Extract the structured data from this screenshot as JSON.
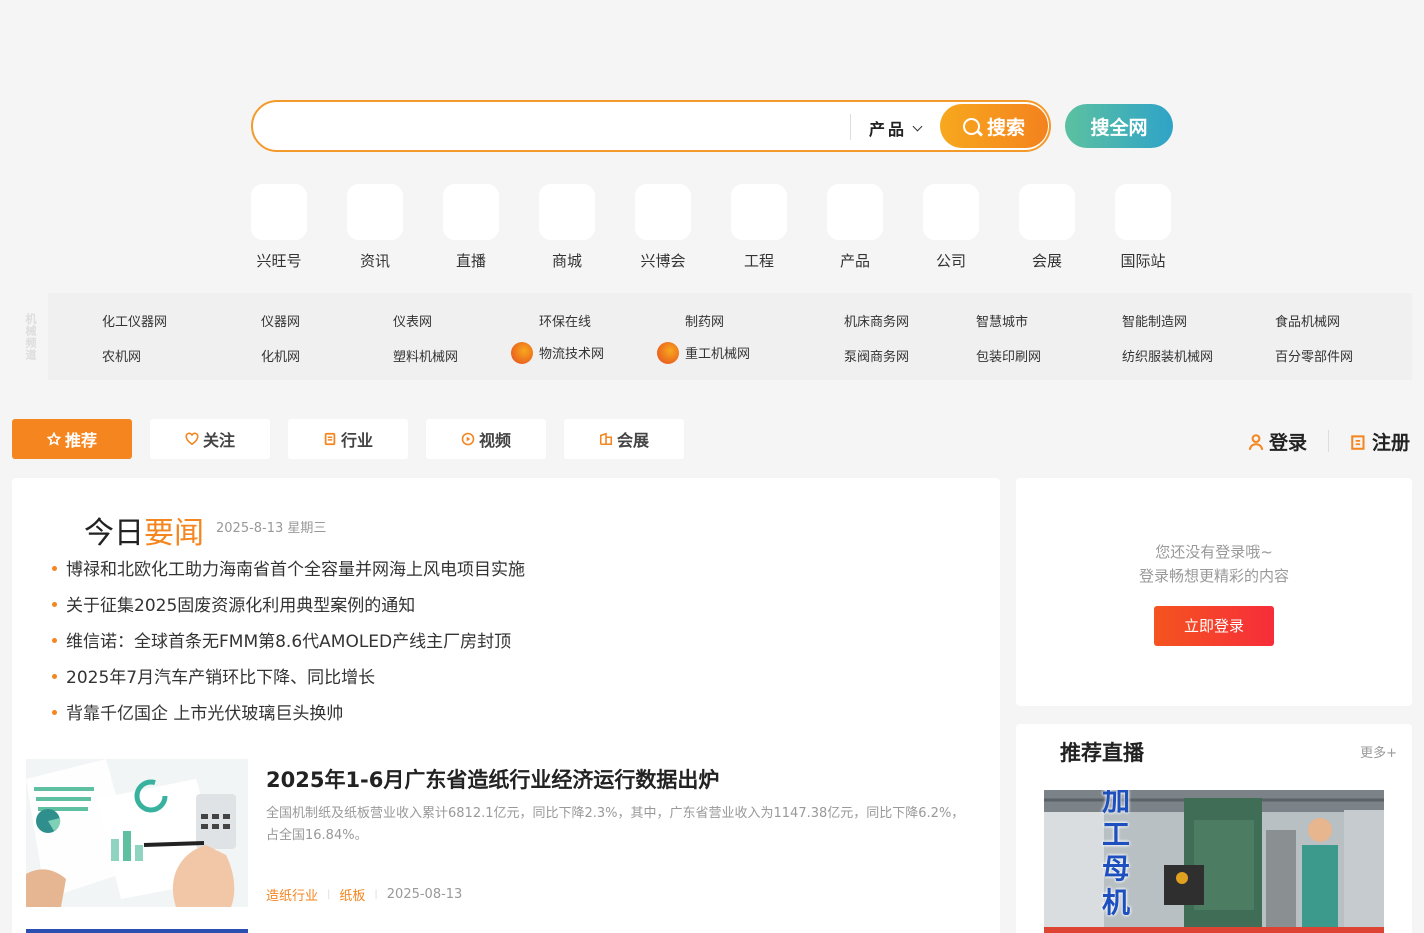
{
  "search": {
    "placeholder": "",
    "type_label": "产品",
    "button_label": "搜索",
    "all_label": "搜全网"
  },
  "nav": [
    {
      "label": "兴旺号"
    },
    {
      "label": "资讯"
    },
    {
      "label": "直播"
    },
    {
      "label": "商城"
    },
    {
      "label": "兴博会"
    },
    {
      "label": "工程"
    },
    {
      "label": "产品"
    },
    {
      "label": "公司"
    },
    {
      "label": "会展"
    },
    {
      "label": "国际站"
    }
  ],
  "links": {
    "side_label": "机械频道",
    "row1": [
      "化工仪器网",
      "仪器网",
      "仪表网",
      "环保在线",
      "制药网",
      "机床商务网",
      "智慧城市",
      "智能制造网",
      "食品机械网"
    ],
    "row2": [
      "农机网",
      "化机网",
      "塑料机械网",
      "物流技术网",
      "重工机械网",
      "泵阀商务网",
      "包装印刷网",
      "纺织服装机械网",
      "百分零部件网"
    ]
  },
  "tabs": [
    {
      "label": "推荐"
    },
    {
      "label": "关注"
    },
    {
      "label": "行业"
    },
    {
      "label": "视频"
    },
    {
      "label": "会展"
    }
  ],
  "auth": {
    "login": "登录",
    "register": "注册"
  },
  "today": {
    "title_a": "今日",
    "title_b": "要闻",
    "date": "2025-8-13 星期三",
    "news": [
      "博禄和北欧化工助力海南省首个全容量并网海上风电项目实施",
      "关于征集2025固废资源化利用典型案例的通知",
      "维信诺：全球首条无FMM第8.6代AMOLED产线主厂房封顶",
      "2025年7月汽车产销环比下降、同比增长",
      "背靠千亿国企 上市光伏玻璃巨头换帅"
    ]
  },
  "article": {
    "title": "2025年1-6月广东省造纸行业经济运行数据出炉",
    "summary": "全国机制纸及纸板营业收入累计6812.1亿元，同比下降2.3%，其中，广东省营业收入为1147.38亿元，同比下降6.2%，占全国16.84%。",
    "tags": [
      "造纸行业",
      "纸板"
    ],
    "date": "2025-08-13"
  },
  "login_card": {
    "line1": "您还没有登录哦~",
    "line2": "登录畅想更精彩的内容",
    "button": "立即登录"
  },
  "live": {
    "title": "推荐直播",
    "more": "更多+",
    "overlay": "加工母机"
  },
  "colors": {
    "accent": "#f4851f",
    "all_search": "#2fa3c8",
    "login_btn": "#f72d3a"
  }
}
